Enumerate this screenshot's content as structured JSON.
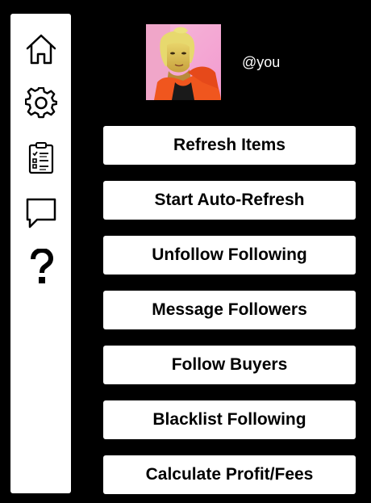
{
  "sidebar": {
    "items": [
      {
        "icon": "home-icon"
      },
      {
        "icon": "gear-icon"
      },
      {
        "icon": "clipboard-checklist-icon"
      },
      {
        "icon": "chat-bubble-icon"
      },
      {
        "icon": "question-mark-icon"
      }
    ]
  },
  "profile": {
    "username": "@you"
  },
  "actions": {
    "refresh_items": "Refresh Items",
    "start_auto_refresh": "Start Auto-Refresh",
    "unfollow_following": "Unfollow Following",
    "message_followers": "Message Followers",
    "follow_buyers": "Follow Buyers",
    "blacklist_following": "Blacklist Following",
    "calculate_profit_fees": "Calculate Profit/Fees"
  },
  "colors": {
    "background": "#000000",
    "panel": "#ffffff",
    "text_dark": "#000000",
    "text_light": "#ffffff"
  }
}
